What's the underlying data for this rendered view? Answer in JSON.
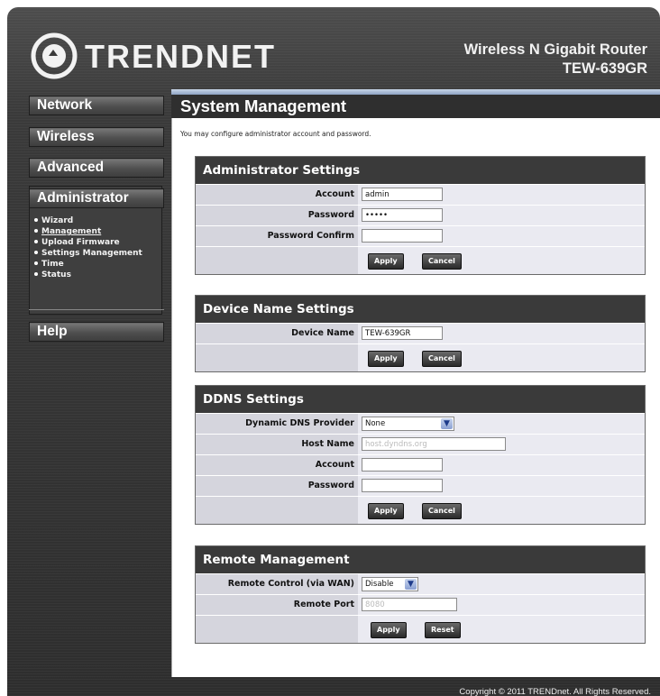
{
  "header": {
    "brand": "TRENDNET",
    "product_name": "Wireless N Gigabit Router",
    "product_model": "TEW-639GR"
  },
  "sidebar": {
    "items": [
      {
        "label": "Network"
      },
      {
        "label": "Wireless"
      },
      {
        "label": "Advanced"
      },
      {
        "label": "Administrator"
      },
      {
        "label": "Help"
      }
    ],
    "admin_submenu": [
      {
        "label": "Wizard"
      },
      {
        "label": "Management",
        "active": true
      },
      {
        "label": "Upload Firmware"
      },
      {
        "label": "Settings Management"
      },
      {
        "label": "Time"
      },
      {
        "label": "Status"
      }
    ]
  },
  "main": {
    "title": "System Management",
    "intro": "You may configure administrator account and password."
  },
  "admin_settings": {
    "heading": "Administrator Settings",
    "account_label": "Account",
    "account_value": "admin",
    "password_label": "Password",
    "password_value": "•••••",
    "confirm_label": "Password Confirm",
    "confirm_value": "",
    "apply": "Apply",
    "cancel": "Cancel"
  },
  "device_name_settings": {
    "heading": "Device Name Settings",
    "name_label": "Device Name",
    "name_value": "TEW-639GR",
    "apply": "Apply",
    "cancel": "Cancel"
  },
  "ddns_settings": {
    "heading": "DDNS Settings",
    "provider_label": "Dynamic DNS Provider",
    "provider_value": "None",
    "host_label": "Host Name",
    "host_placeholder": "host.dyndns.org",
    "account_label": "Account",
    "account_value": "",
    "password_label": "Password",
    "password_value": "",
    "apply": "Apply",
    "cancel": "Cancel"
  },
  "remote_management": {
    "heading": "Remote Management",
    "control_label": "Remote Control (via WAN)",
    "control_value": "Disable",
    "port_label": "Remote Port",
    "port_value": "8080",
    "apply": "Apply",
    "reset": "Reset"
  },
  "footer": {
    "copyright": "Copyright © 2011 TRENDnet. All Rights Reserved."
  },
  "colors": {
    "background": "#3a3a3a",
    "section_header": "#3a3a3a",
    "label_cell": "#d5d5dd",
    "value_cell": "#eaeaf1",
    "accent_bar": "#8ea4c4"
  }
}
